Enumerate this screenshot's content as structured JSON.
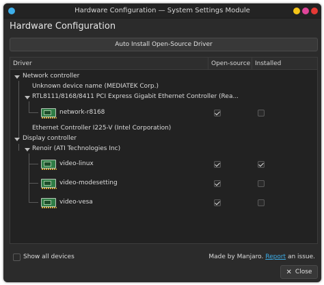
{
  "window": {
    "title": "Hardware Configuration — System Settings Module",
    "controls_colors": {
      "yellow": "#f5c518",
      "pink": "#e0459a",
      "red": "#e53935"
    },
    "app_icon_color": "#3daee9"
  },
  "heading": "Hardware Configuration",
  "auto_install_label": "Auto Install Open-Source Driver",
  "table": {
    "headers": {
      "driver": "Driver",
      "open_source": "Open-source",
      "installed": "Installed"
    }
  },
  "tree": {
    "network_controller": "Network controller",
    "unknown_device": "Unknown device name (MEDIATEK Corp.)",
    "rtl": "RTL8111/8168/8411 PCI Express Gigabit Ethernet Controller (Rea...",
    "network_r8168": {
      "name": "network-r8168",
      "open_source": true,
      "installed": false
    },
    "ethernet_i225": "Ethernet Controller I225-V (Intel Corporation)",
    "display_controller": "Display controller",
    "renoir": "Renoir (ATI Technologies Inc)",
    "video_linux": {
      "name": "video-linux",
      "open_source": true,
      "installed": true
    },
    "video_modesetting": {
      "name": "video-modesetting",
      "open_source": true,
      "installed": false
    },
    "video_vesa": {
      "name": "video-vesa",
      "open_source": true,
      "installed": false
    }
  },
  "footer": {
    "show_all_label": "Show all devices",
    "made_by": "Made by Manjaro.",
    "report_link": "Report",
    "an_issue": "an issue.",
    "close_label": "Close"
  }
}
